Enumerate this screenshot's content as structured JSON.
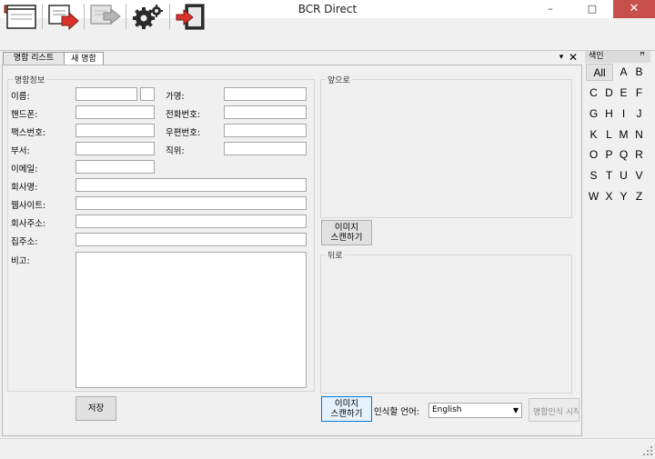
{
  "window": {
    "title": "BCR Direct",
    "minimize": "–",
    "maximize": "□",
    "close": "✕"
  },
  "toolbar": {
    "icons": [
      "notepad-icon",
      "save-to-file-icon",
      "export-disabled-icon",
      "settings-gears-icon",
      "exit-door-icon"
    ]
  },
  "tabs": [
    {
      "label": "명함 리스트",
      "active": false
    },
    {
      "label": "새 명함",
      "active": true
    }
  ],
  "pane": {
    "pin": "▾",
    "close": "✕"
  },
  "card_info": {
    "group_label": "명함정보",
    "name": {
      "label": "이름:",
      "value": "",
      "value2": ""
    },
    "company_name": {
      "label": "가명:",
      "value": ""
    },
    "mobile": {
      "label": "핸드폰:",
      "value": ""
    },
    "phone": {
      "label": "전화번호:",
      "value": ""
    },
    "fax": {
      "label": "팩스번호:",
      "value": ""
    },
    "zipcode": {
      "label": "우편번호:",
      "value": ""
    },
    "department": {
      "label": "부서:",
      "value": ""
    },
    "position": {
      "label": "직위:",
      "value": ""
    },
    "email": {
      "label": "이메일:",
      "value": ""
    },
    "company": {
      "label": "회사명:",
      "value": ""
    },
    "website": {
      "label": "웹사이트:",
      "value": ""
    },
    "company_address": {
      "label": "회사주소:",
      "value": ""
    },
    "home_address": {
      "label": "집주소:",
      "value": ""
    },
    "notes": {
      "label": "비고:",
      "value": ""
    }
  },
  "front": {
    "label": "앞으로",
    "scan_button": "이미지\n스캔하기"
  },
  "back": {
    "label": "뒤로",
    "scan_button": "이미지\n스캔하기"
  },
  "save_button": "저장",
  "recognition": {
    "label": "인식할 언어:",
    "selected": "English",
    "start_button": "명함인식 시작"
  },
  "index_panel": {
    "title": "색인",
    "pin": "ꟸ",
    "letters": [
      "All",
      "A",
      "B",
      "C",
      "D",
      "E",
      "F",
      "G",
      "H",
      "I",
      "J",
      "K",
      "L",
      "M",
      "N",
      "O",
      "P",
      "Q",
      "R",
      "S",
      "T",
      "U",
      "V",
      "W",
      "X",
      "Y",
      "Z"
    ]
  }
}
